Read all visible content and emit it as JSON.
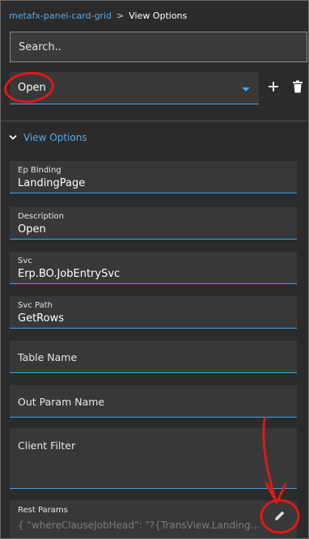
{
  "breadcrumb": {
    "parent": "metafx-panel-card-grid",
    "separator": ">",
    "current": "View Options"
  },
  "search": {
    "placeholder": "Search.."
  },
  "selector": {
    "value": "Open"
  },
  "section": {
    "title": "View Options"
  },
  "fields": {
    "ep_binding": {
      "label": "Ep Binding",
      "value": "LandingPage"
    },
    "description": {
      "label": "Description",
      "value": "Open"
    },
    "svc": {
      "label": "Svc",
      "value": "Erp.BO.JobEntrySvc"
    },
    "svc_path": {
      "label": "Svc Path",
      "value": "GetRows"
    },
    "table_name": {
      "placeholder": "Table Name"
    },
    "out_param_name": {
      "placeholder": "Out Param Name"
    },
    "client_filter": {
      "placeholder": "Client Filter"
    },
    "rest_params": {
      "label": "Rest Params",
      "value": "{ \"whereClauseJobHead\": \"?{TransView.LandingP..."
    }
  },
  "icons": {
    "add": "plus-icon",
    "delete": "trash-icon",
    "expand": "chevron-down-icon",
    "edit": "pencil-icon",
    "dropdown": "caret-down-icon"
  },
  "colors": {
    "background": "#2b2b2b",
    "field_background": "#383838",
    "accent": "#3ea6ef",
    "link": "#5aa9e6",
    "annotation": "#e01818"
  }
}
